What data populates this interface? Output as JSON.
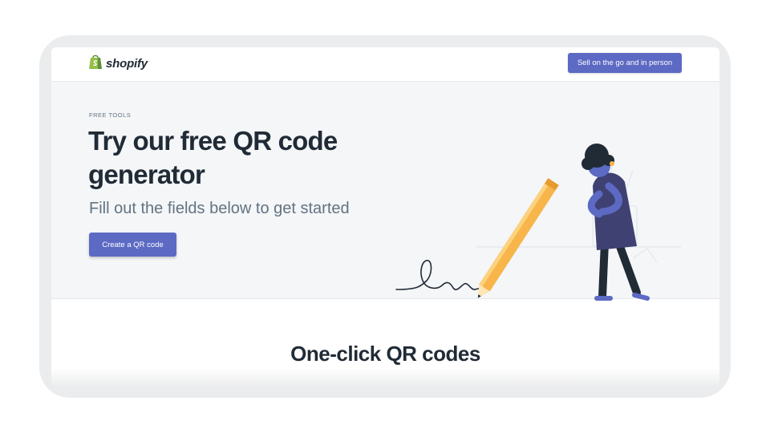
{
  "header": {
    "logo_text": "shopify",
    "cta_label": "Sell on the go and in person"
  },
  "hero": {
    "eyebrow": "FREE TOOLS",
    "title": "Try our free QR code generator",
    "subtitle": "Fill out the fields below to get started",
    "cta_label": "Create a QR code"
  },
  "section": {
    "title": "One-click QR codes"
  },
  "colors": {
    "brand_green": "#95bf47",
    "accent": "#5c6ac4",
    "heading": "#212b36",
    "muted": "#637381",
    "hero_bg": "#f4f6f8"
  },
  "icons": {
    "logo": "shopify-bag-icon",
    "illustration": "person-with-giant-pencil-illustration"
  }
}
